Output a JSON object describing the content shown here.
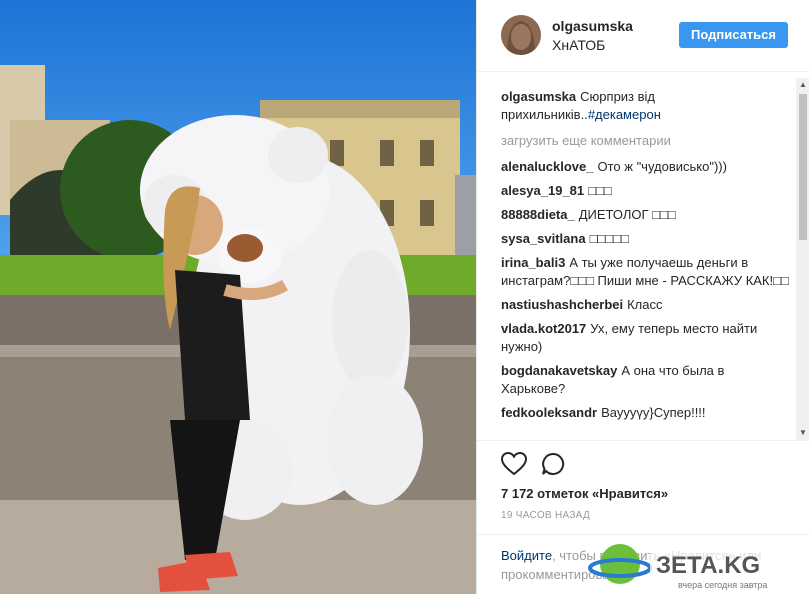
{
  "header": {
    "username": "olgasumska",
    "location": "ХнАТОБ",
    "follow_label": "Подписаться"
  },
  "caption": {
    "user": "olgasumska",
    "text": "Сюрприз від прихильників..",
    "hashtag": "#декамерон"
  },
  "load_more": "загрузить еще комментарии",
  "comments": [
    {
      "user": "alenalucklove_",
      "text": "Ото ж \"чудовисько\")))"
    },
    {
      "user": "alesya_19_81",
      "text": "□□□"
    },
    {
      "user": "88888dieta_",
      "text": "ДИЕТОЛОГ □□□"
    },
    {
      "user": "sysa_svitlana",
      "text": "□□□□□"
    },
    {
      "user": "irina_bali3",
      "text": "А ты уже получаешь деньги в инстаграм?□□□ Пиши мне - РАССКАЖУ КАК!□□"
    },
    {
      "user": "nastiushashcherbei",
      "text": "Класс"
    },
    {
      "user": "vlada.kot2017",
      "text": "Ух, ему теперь место найти нужно)"
    },
    {
      "user": "bogdanakavetskay",
      "text": "А она что была в Харькове?"
    },
    {
      "user": "fedkooleksandr",
      "text": "Вауууүу}Супер!!!!"
    }
  ],
  "likes": "7 172 отметок «Нравится»",
  "time": "19 ЧАСОВ НАЗАД",
  "login": {
    "link": "Войдите",
    "text": ", чтобы поставить «Нравится» или прокомментировать."
  },
  "watermark": {
    "brand": "ЗЕТА.KG",
    "tagline": "вчера сегодня завтра"
  },
  "colors": {
    "accent": "#3897f0",
    "link": "#003569",
    "muted": "#999999"
  },
  "icons": [
    "heart-icon",
    "comment-icon",
    "scroll-up-icon",
    "scroll-down-icon"
  ]
}
